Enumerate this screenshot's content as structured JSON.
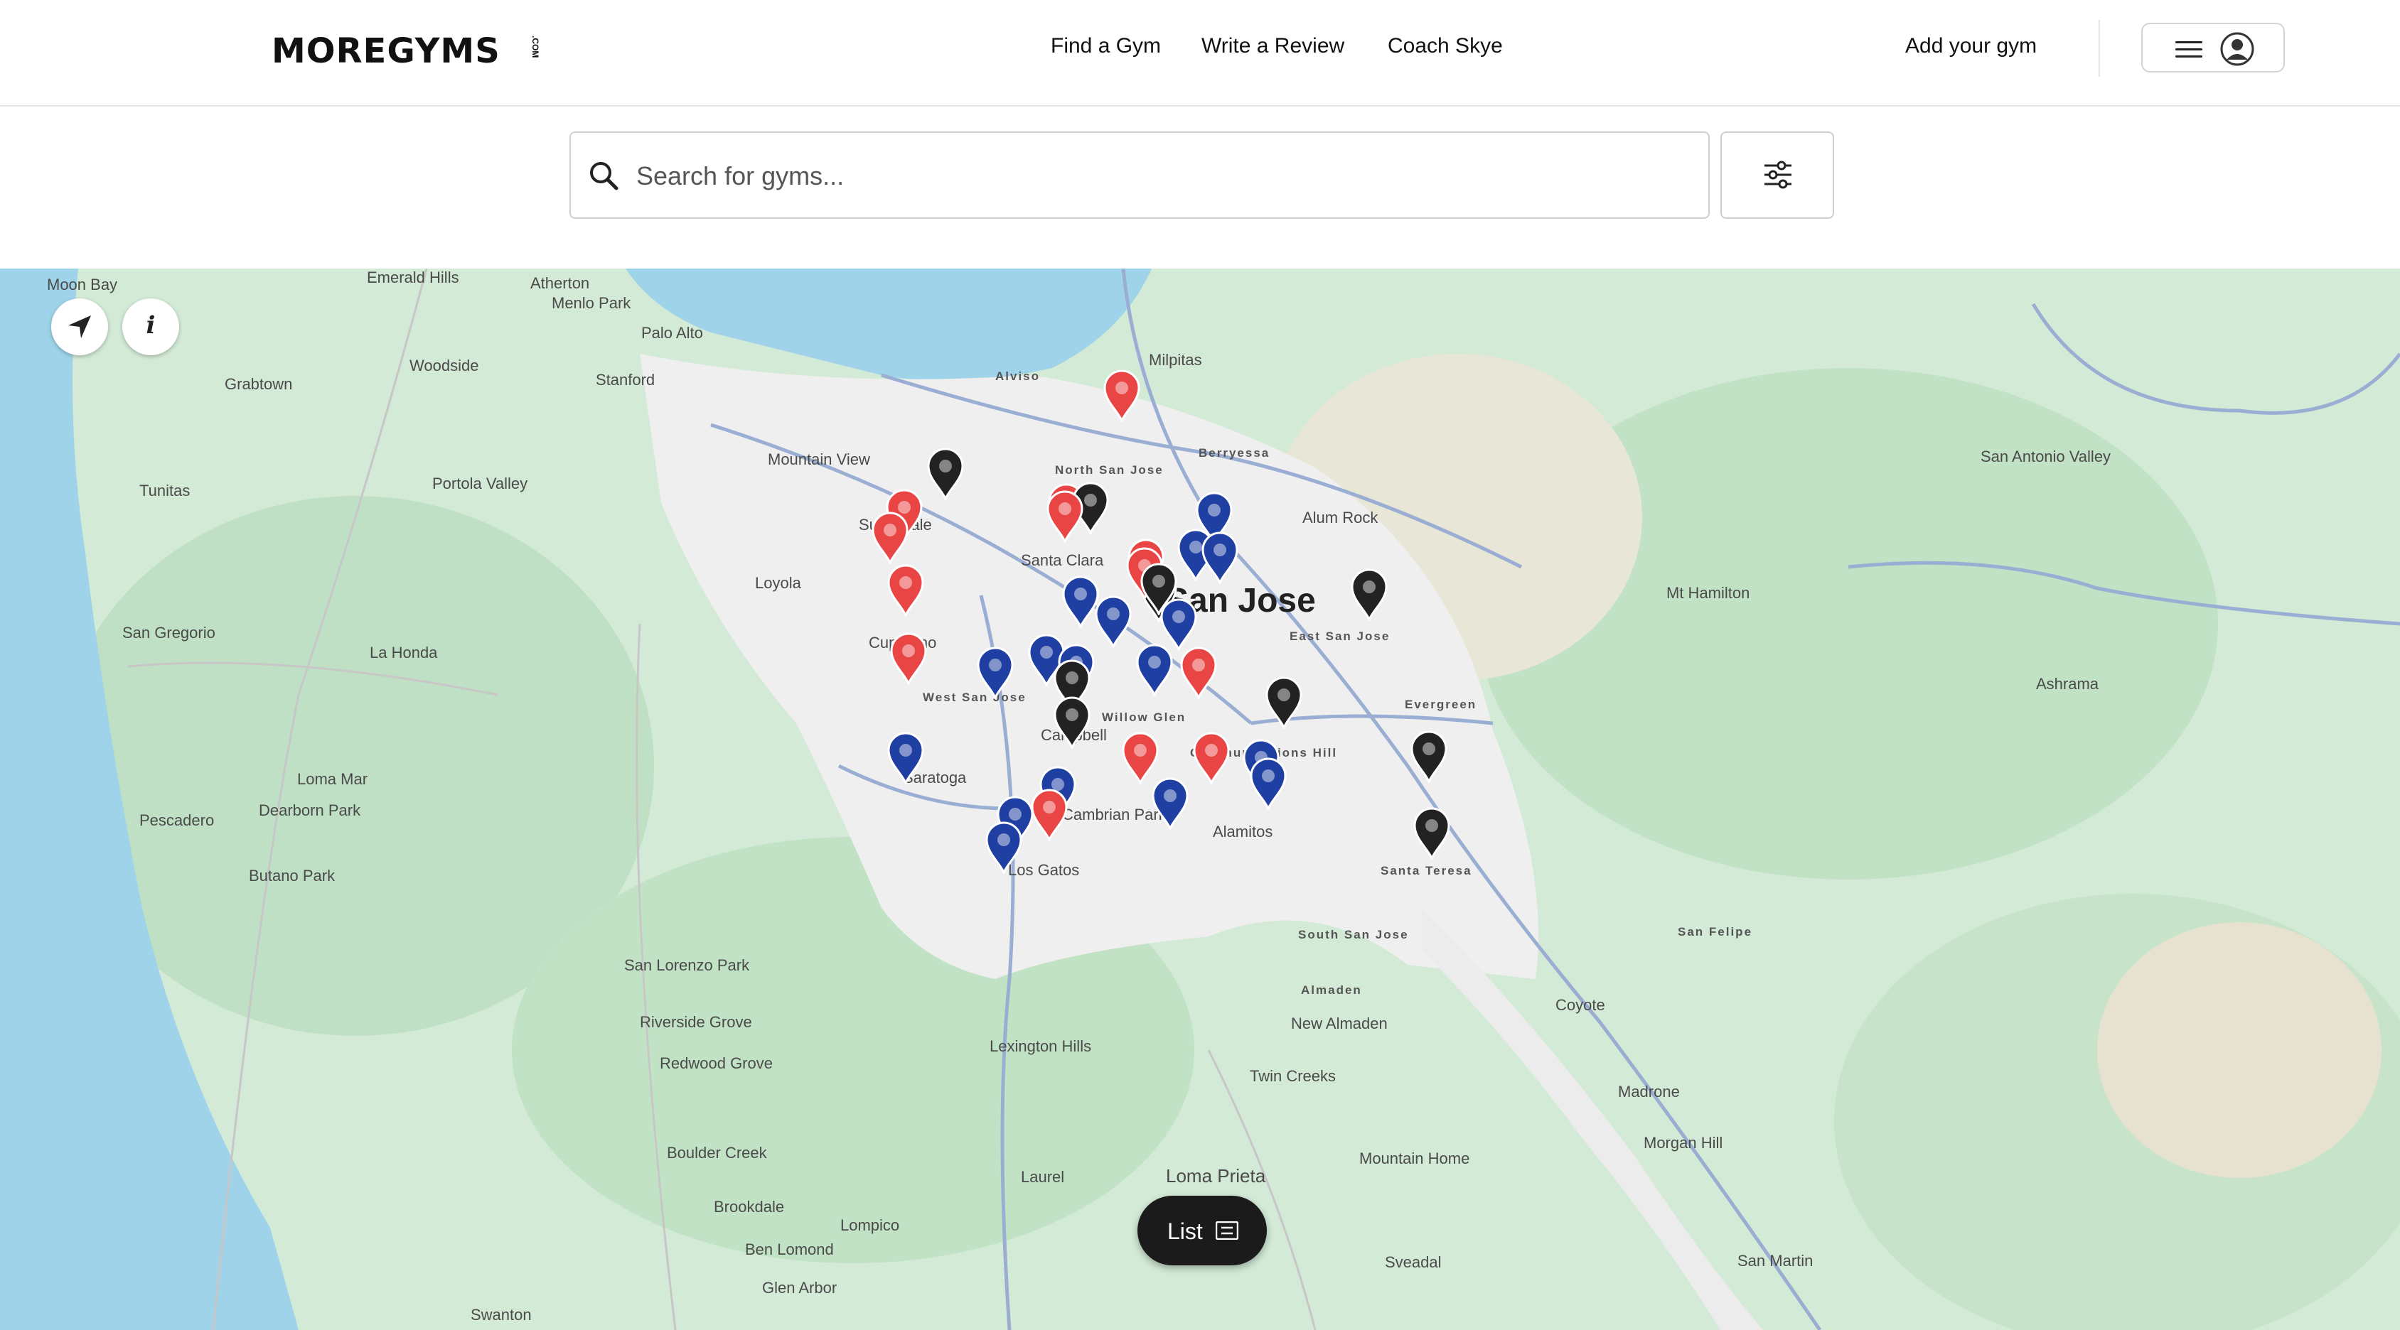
{
  "header": {
    "logo": "MOREGYMS",
    "logo_suffix": ".COM",
    "nav": [
      {
        "label": "Find a Gym"
      },
      {
        "label": "Write a Review"
      },
      {
        "label": "Coach Skye"
      }
    ],
    "add_gym": "Add your gym",
    "menu_icons": [
      "hamburger-icon",
      "user-circle-icon"
    ]
  },
  "search": {
    "placeholder": "Search for gyms...",
    "value": "",
    "icon": "search-icon",
    "filter_icon": "sliders-icon"
  },
  "map": {
    "controls": {
      "locate_icon": "navigation-arrow-icon",
      "info_label": "i"
    },
    "list_button": {
      "label": "List",
      "icon": "list-icon"
    },
    "colors": {
      "water": "#9fd3ea",
      "land": "#cfe8d4",
      "urban": "#eeeeee",
      "pin_red": "#e94545",
      "pin_blue": "#1f3fa3",
      "pin_black": "#222222"
    },
    "places": [
      "Moon Bay",
      "Emerald Hills",
      "Atherton",
      "Menlo Park",
      "Palo Alto",
      "Woodside",
      "Stanford",
      "Grabtown",
      "Tunitas",
      "Portola Valley",
      "Mountain View",
      "Alviso",
      "Milpitas",
      "North San Jose",
      "Berryessa",
      "Sunnyvale",
      "Santa Clara",
      "Alum Rock",
      "San Jose",
      "East San Jose",
      "Loyola",
      "Cupertino",
      "San Gregorio",
      "La Honda",
      "West San Jose",
      "Willow Glen",
      "Campbell",
      "Communications Hill",
      "Evergreen",
      "Saratoga",
      "Cambrian Park",
      "Alamitos",
      "Los Gatos",
      "Santa Teresa",
      "Loma Mar",
      "Dearborn Park",
      "Pescadero",
      "Butano Park",
      "South San Jose",
      "San Felipe",
      "Almaden",
      "New Almaden",
      "Coyote",
      "San Lorenzo Park",
      "Riverside Grove",
      "Redwood Grove",
      "Lexington Hills",
      "Twin Creeks",
      "Madrone",
      "Boulder Creek",
      "Morgan Hill",
      "Loma Prieta",
      "Mountain Home",
      "Laurel",
      "Brookdale",
      "Lompico",
      "Ben Lomond",
      "Sveadal",
      "San Martin",
      "Glen Arbor",
      "Swanton",
      "San Antonio Valley",
      "Mt Hamilton",
      "Ashrama"
    ],
    "pins": [
      {
        "color": "red"
      },
      {
        "color": "black"
      },
      {
        "color": "red"
      },
      {
        "color": "red"
      },
      {
        "color": "red"
      },
      {
        "color": "red"
      },
      {
        "color": "black"
      },
      {
        "color": "red"
      },
      {
        "color": "blue"
      },
      {
        "color": "blue"
      },
      {
        "color": "blue"
      },
      {
        "color": "red"
      },
      {
        "color": "black"
      },
      {
        "color": "blue"
      },
      {
        "color": "blue"
      },
      {
        "color": "blue"
      },
      {
        "color": "black"
      },
      {
        "color": "red"
      },
      {
        "color": "blue"
      },
      {
        "color": "blue"
      },
      {
        "color": "blue"
      },
      {
        "color": "black"
      },
      {
        "color": "black"
      },
      {
        "color": "blue"
      },
      {
        "color": "red"
      },
      {
        "color": "black"
      },
      {
        "color": "red"
      },
      {
        "color": "red"
      },
      {
        "color": "blue"
      },
      {
        "color": "blue"
      },
      {
        "color": "black"
      },
      {
        "color": "blue"
      },
      {
        "color": "blue"
      },
      {
        "color": "blue"
      },
      {
        "color": "red"
      },
      {
        "color": "blue"
      },
      {
        "color": "black"
      },
      {
        "color": "blue"
      },
      {
        "color": "black"
      },
      {
        "color": "red"
      }
    ]
  }
}
